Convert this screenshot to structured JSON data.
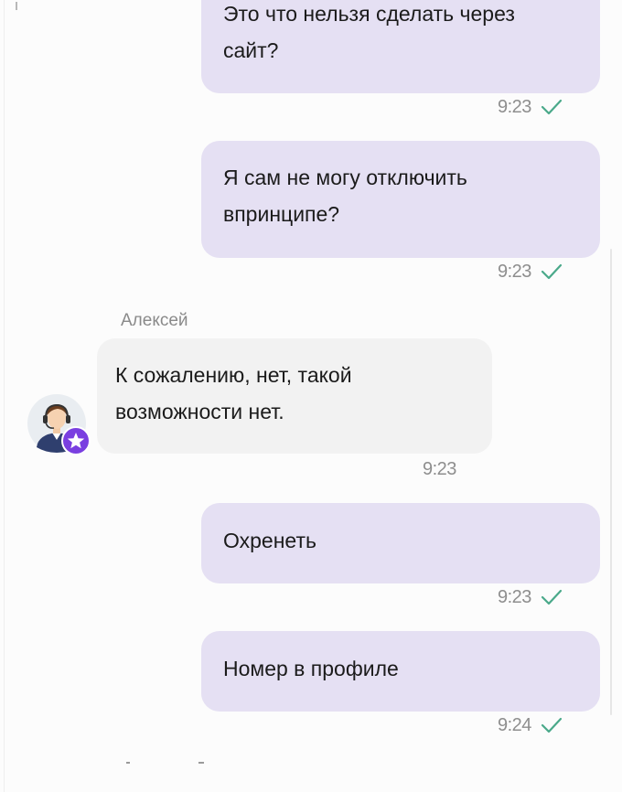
{
  "messages": [
    {
      "text_lines": [
        "Это что нельзя сделать через",
        "сайт?"
      ],
      "time": "9:23",
      "direction": "outgoing",
      "status_icon": "check-icon"
    },
    {
      "text_lines": [
        "Я сам не могу отключить",
        "впринципе?"
      ],
      "time": "9:23",
      "direction": "outgoing",
      "status_icon": "check-icon"
    },
    {
      "sender": "Алексей",
      "text_lines": [
        "К сожалению, нет, такой",
        "возможности нет."
      ],
      "time": "9:23",
      "direction": "incoming"
    },
    {
      "text_lines": [
        "Охренеть"
      ],
      "time": "9:23",
      "direction": "outgoing",
      "status_icon": "check-icon"
    },
    {
      "text_lines": [
        "Номер в профиле"
      ],
      "time": "9:24",
      "direction": "outgoing",
      "status_icon": "check-icon"
    }
  ],
  "colors": {
    "outgoing_bubble": "#e5e0f3",
    "incoming_bubble": "#f2f2f2",
    "check_mark": "#4aa98a",
    "badge": "#7a3fe0"
  }
}
